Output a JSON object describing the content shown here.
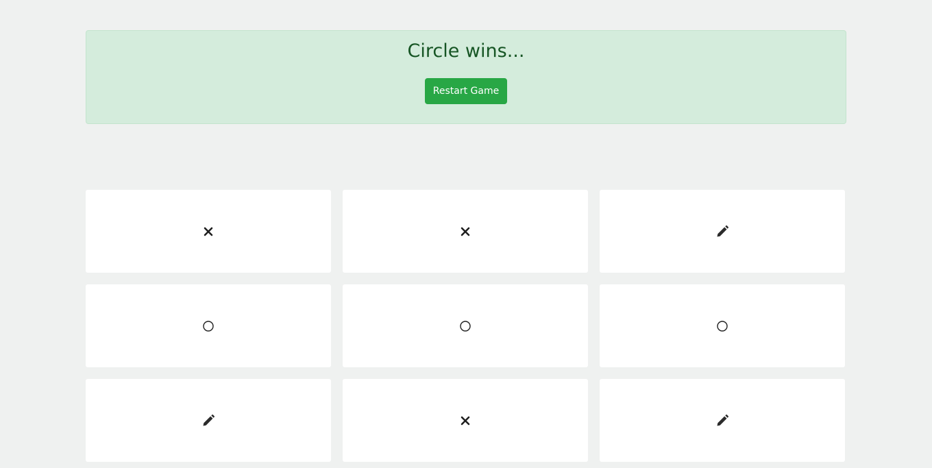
{
  "banner": {
    "title": "Circle wins...",
    "restart_label": "Restart Game",
    "background": "#d4ecdc",
    "title_color": "#165524",
    "button_color": "#28a745"
  },
  "board": {
    "cells": [
      {
        "mark": "x",
        "icon": "x-icon"
      },
      {
        "mark": "x",
        "icon": "x-icon"
      },
      {
        "mark": "empty",
        "icon": "pencil-icon"
      },
      {
        "mark": "o",
        "icon": "circle-icon"
      },
      {
        "mark": "o",
        "icon": "circle-icon"
      },
      {
        "mark": "o",
        "icon": "circle-icon"
      },
      {
        "mark": "empty",
        "icon": "pencil-icon"
      },
      {
        "mark": "x",
        "icon": "x-icon"
      },
      {
        "mark": "empty",
        "icon": "pencil-icon"
      }
    ]
  }
}
